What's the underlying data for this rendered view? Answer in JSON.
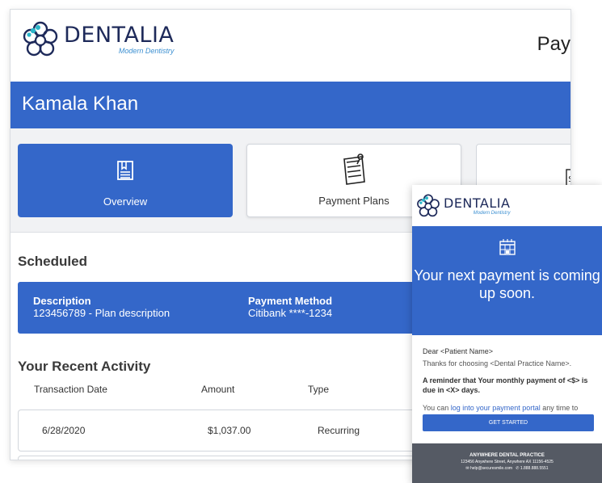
{
  "brand": {
    "name": "DENTALIA",
    "tagline": "Modern Dentistry",
    "accent": "#3467c9",
    "teal": "#2bb5c9",
    "navy": "#1e2a5a"
  },
  "header": {
    "right_text": "Pay"
  },
  "patient": {
    "name": "Kamala Khan"
  },
  "tabs": [
    {
      "label": "Overview",
      "icon": "document-icon",
      "active": true
    },
    {
      "label": "Payment Plans",
      "icon": "payment-plan-icon",
      "active": false
    },
    {
      "label": "",
      "icon": "billing-icon",
      "active": false
    }
  ],
  "scheduled": {
    "title": "Scheduled",
    "description_header": "Description",
    "description_value": "123456789 - Plan description",
    "method_header": "Payment Method",
    "method_value": "Citibank ****-1234"
  },
  "activity": {
    "title": "Your Recent Activity",
    "columns": [
      "Transaction Date",
      "Amount",
      "Type"
    ],
    "rows": [
      {
        "date": "6/28/2020",
        "amount": "$1,037.00",
        "type": "Recurring"
      }
    ]
  },
  "email": {
    "logo_name": "DENTALIA",
    "logo_tagline": "Modern Dentistry",
    "headline": "Your next payment is coming up soon.",
    "greeting": "Dear <Patient Name>",
    "thanks": "Thanks for choosing <Dental Practice Name>.",
    "reminder": "A reminder that Your monthly payment of <$> is due in <X> days.",
    "portal_prefix": "You can ",
    "portal_link": "log into your payment portal",
    "portal_suffix": " any time to view your plan or make a payment.",
    "cta": "GET STARTED",
    "footer_name": "ANYWHERE DENTAL PRACTICE",
    "footer_address": "123456 Anywhere Street, Anywhere AX 11156-4525",
    "footer_email": "help@securesmile.com",
    "footer_phone": "1.888.888.5551"
  }
}
